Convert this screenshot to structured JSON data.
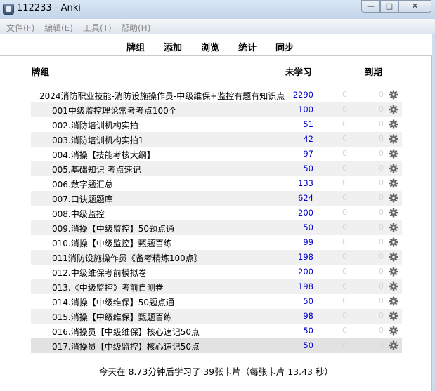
{
  "window": {
    "title": "112233 - Anki",
    "min": "—",
    "max": "□",
    "close": "✕"
  },
  "menu": [
    "文件(F)",
    "编辑(E)",
    "工具(T)",
    "帮助(H)"
  ],
  "toolbar": [
    "牌组",
    "添加",
    "浏览",
    "统计",
    "同步"
  ],
  "headers": {
    "deck": "牌组",
    "new": "未学习",
    "due": "到期"
  },
  "decks": [
    {
      "name": "2024消防职业技能-消防设施操作员-中级维保+监控有题有知识点",
      "new": "2290",
      "a": "0",
      "b": "0",
      "collapse": "-"
    },
    {
      "name": "001中级监控理论常考考点100个",
      "new": "100",
      "a": "0",
      "b": "0"
    },
    {
      "name": "002.消防培训机构实拍",
      "new": "51",
      "a": "0",
      "b": "0"
    },
    {
      "name": "003.消防培训机构实拍1",
      "new": "42",
      "a": "0",
      "b": "0"
    },
    {
      "name": "004.消操【技能考核大纲】",
      "new": "97",
      "a": "0",
      "b": "0"
    },
    {
      "name": "005.基础知识 考点速记",
      "new": "50",
      "a": "0",
      "b": "0"
    },
    {
      "name": "006.数字题汇总",
      "new": "133",
      "a": "0",
      "b": "0"
    },
    {
      "name": "007.口诀题题库",
      "new": "624",
      "a": "0",
      "b": "0"
    },
    {
      "name": "008.中级监控",
      "new": "200",
      "a": "0",
      "b": "0"
    },
    {
      "name": "009.消操【中级监控】50题点通",
      "new": "50",
      "a": "0",
      "b": "0"
    },
    {
      "name": "010.消操【中级监控】甄题百练",
      "new": "99",
      "a": "0",
      "b": "0"
    },
    {
      "name": "011消防设施操作员《备考精炼100点》",
      "new": "198",
      "a": "0",
      "b": "0"
    },
    {
      "name": "012.中级维保考前模拟卷",
      "new": "200",
      "a": "0",
      "b": "0"
    },
    {
      "name": "013.《中级监控》考前自测卷",
      "new": "198",
      "a": "0",
      "b": "0"
    },
    {
      "name": "014.消操【中级维保】50题点通",
      "new": "50",
      "a": "0",
      "b": "0"
    },
    {
      "name": "015.消操【中级维保】甄题百练",
      "new": "98",
      "a": "0",
      "b": "0"
    },
    {
      "name": "016.消操员【中级维保】核心速记50点",
      "new": "50",
      "a": "0",
      "b": "0"
    },
    {
      "name": "017.消操员【中级监控】核心速记50点",
      "new": "50",
      "a": "0",
      "b": "0"
    }
  ],
  "stats": "今天在 8.73分钟后学习了 39张卡片（每张卡片 13.43 秒）",
  "colors": {
    "new_count": "#0000cc",
    "zero_count": "#d6d6d6",
    "alt_row": "#f0f0f0"
  }
}
